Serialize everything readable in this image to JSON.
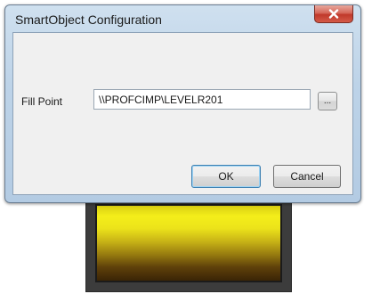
{
  "window": {
    "title": "SmartObject Configuration"
  },
  "form": {
    "fill_point_label": "Fill Point",
    "fill_point_value": "\\\\PROFCIMP\\LEVELR201",
    "browse_label": "..."
  },
  "buttons": {
    "ok_label": "OK",
    "cancel_label": "Cancel"
  },
  "icons": {
    "close": "close-icon"
  },
  "colors": {
    "title_bar": "#bdd3e8",
    "close_button": "#c0392b",
    "tank_frame": "#3c3c3c",
    "tank_fill_top": "#f4ee1a",
    "tank_fill_bottom": "#3a2406"
  }
}
